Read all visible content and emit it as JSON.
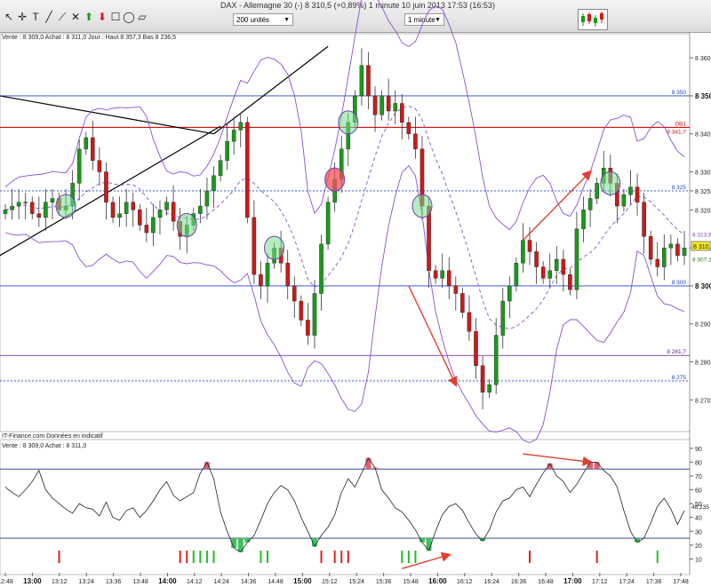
{
  "window": {
    "title": "DAX - Allemagne 30 (-)     8 310,5 (+0,89%)     1 minute  10 juin 2013 17:53 (16:53)"
  },
  "toolbar": {
    "units_select": "200 unités",
    "period_select": "1 minute",
    "tools": [
      "cursor-icon",
      "crosshair-icon",
      "text-tool-icon",
      "line-tool-icon",
      "ray-tool-icon",
      "cross-tool-icon",
      "arrow-up-icon",
      "arrow-down-icon",
      "rectangle-tool-icon",
      "ellipse-tool-icon",
      "channel-tool-icon"
    ]
  },
  "main_panel": {
    "info": "Vente : 8 309,0  Achat : 8 311,0  Jour : Haut 8 357,3  Bas 8 236,5",
    "source": "IT-Finance.com   Données en indicatif",
    "last_price": "8 310,5",
    "price_labels": [
      {
        "label": "8 313,6",
        "value": 8313.6,
        "color": "#7b3fbf"
      },
      {
        "label": "8 307,1",
        "value": 8307.1,
        "color": "#1a7a1a"
      }
    ],
    "levels": [
      {
        "label": "8 350",
        "value": 8350,
        "color": "#1f47c8",
        "style": "solid"
      },
      {
        "label": "DB1",
        "value": 8341.7,
        "color": "#d01010",
        "style": "solid",
        "value_label": "8 341,7"
      },
      {
        "label": "8 325",
        "value": 8325,
        "color": "#1f47c8",
        "style": "dashed"
      },
      {
        "label": "8 300",
        "value": 8300,
        "color": "#1f47c8",
        "style": "solid"
      },
      {
        "label": "8 281,7",
        "value": 8281.7,
        "color": "#5b1a99",
        "style": "solid"
      },
      {
        "label": "8 275",
        "value": 8275,
        "color": "#1f47c8",
        "style": "dashed"
      }
    ]
  },
  "oscillator_panel": {
    "info": "Vente : 8 309,0  Achat : 8 311,0",
    "value_label": "48,235",
    "upper": 75,
    "lower": 25
  },
  "time_axis": [
    "12:48",
    "13:00",
    "13:12",
    "13:24",
    "13:36",
    "13:48",
    "14:00",
    "14:12",
    "14:24",
    "14:36",
    "14:48",
    "15:00",
    "15:12",
    "15:24",
    "15:36",
    "15:48",
    "16:00",
    "16:12",
    "16:24",
    "16:36",
    "16:48",
    "17:00",
    "17:12",
    "17:24",
    "17:36",
    "17:48"
  ],
  "chart_data": {
    "type": "candlestick",
    "price_axis": {
      "ticks": [
        8360,
        8350,
        8340,
        8330,
        8325,
        8320,
        8310,
        8300,
        8290,
        8280,
        8270
      ],
      "range": [
        8264,
        8364
      ]
    },
    "oscillator_axis": {
      "ticks": [
        90,
        80,
        70,
        60,
        50,
        40,
        30,
        20,
        10
      ],
      "range": [
        0,
        95
      ]
    },
    "price_close": [
      8320,
      8321,
      8322,
      8322,
      8319,
      8318,
      8322,
      8323,
      8320,
      8321,
      8327,
      8336,
      8339,
      8333,
      8330,
      8322,
      8318,
      8319,
      8322,
      8320,
      8316,
      8314,
      8318,
      8320,
      8322,
      8317,
      8313,
      8316,
      8319,
      8321,
      8325,
      8329,
      8333,
      8338,
      8341,
      8343,
      8318,
      8303,
      8300,
      8306,
      8310,
      8306,
      8300,
      8296,
      8291,
      8287,
      8298,
      8311,
      8322,
      8328,
      8336,
      8343,
      8350,
      8358,
      8350,
      8345,
      8350,
      8346,
      8348,
      8343,
      8340,
      8336,
      8321,
      8304,
      8302,
      8304,
      8300,
      8298,
      8293,
      8288,
      8279,
      8272,
      8274,
      8287,
      8296,
      8300,
      8306,
      8312,
      8309,
      8305,
      8302,
      8304,
      8307,
      8303,
      8299,
      8315,
      8320,
      8323,
      8327,
      8331,
      8327,
      8321,
      8324,
      8326,
      8322,
      8313,
      8307,
      8305,
      8310,
      8311,
      8308,
      8310
    ],
    "rsi": [
      62,
      58,
      55,
      60,
      66,
      74,
      60,
      54,
      50,
      46,
      43,
      50,
      47,
      46,
      41,
      51,
      40,
      38,
      45,
      47,
      40,
      45,
      52,
      60,
      66,
      56,
      52,
      55,
      58,
      72,
      80,
      68,
      44,
      30,
      18,
      15,
      22,
      27,
      38,
      50,
      58,
      63,
      60,
      52,
      40,
      30,
      19,
      27,
      33,
      42,
      58,
      68,
      62,
      72,
      83,
      76,
      60,
      54,
      47,
      44,
      38,
      31,
      22,
      16,
      30,
      42,
      48,
      50,
      45,
      36,
      28,
      23,
      31,
      44,
      52,
      54,
      60,
      62,
      55,
      64,
      72,
      79,
      70,
      66,
      58,
      64,
      72,
      80,
      80,
      74,
      70,
      62,
      45,
      30,
      22,
      25,
      36,
      48,
      54,
      46,
      35,
      45
    ],
    "signals": [
      {
        "i": 8,
        "color": "red"
      },
      {
        "i": 26,
        "color": "red"
      },
      {
        "i": 27,
        "color": "red"
      },
      {
        "i": 28,
        "color": "green"
      },
      {
        "i": 29,
        "color": "green"
      },
      {
        "i": 30,
        "color": "green"
      },
      {
        "i": 31,
        "color": "green"
      },
      {
        "i": 38,
        "color": "green"
      },
      {
        "i": 39,
        "color": "green"
      },
      {
        "i": 47,
        "color": "red"
      },
      {
        "i": 49,
        "color": "red"
      },
      {
        "i": 50,
        "color": "red"
      },
      {
        "i": 51,
        "color": "red"
      },
      {
        "i": 59,
        "color": "green"
      },
      {
        "i": 60,
        "color": "green"
      },
      {
        "i": 61,
        "color": "green"
      },
      {
        "i": 78,
        "color": "red"
      },
      {
        "i": 88,
        "color": "red"
      },
      {
        "i": 97,
        "color": "green"
      }
    ],
    "circles": [
      {
        "i": 9,
        "color": "green"
      },
      {
        "i": 27,
        "color": "green"
      },
      {
        "i": 40,
        "color": "green"
      },
      {
        "i": 49,
        "color": "red"
      },
      {
        "i": 51,
        "color": "green"
      },
      {
        "i": 62,
        "color": "green"
      },
      {
        "i": 90,
        "color": "green"
      }
    ],
    "colors": {
      "up": "#1a9a1a",
      "down": "#cc1a1a",
      "bollinger": "#8a4fd0",
      "rsi": "#222222",
      "overbought": "#e06070",
      "oversold": "#40c060",
      "arrow": "#e04030"
    }
  }
}
